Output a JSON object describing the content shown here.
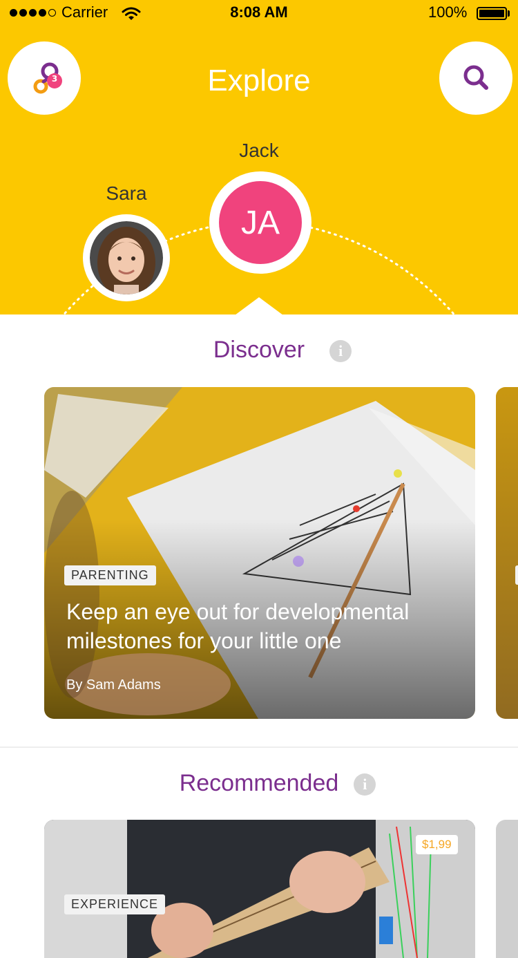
{
  "status_bar": {
    "carrier": "Carrier",
    "time": "8:08 AM",
    "battery": "100%"
  },
  "header": {
    "title": "Explore",
    "notification_count": "3",
    "background_color": "#FCC800",
    "accent_color": "#7B2E8E"
  },
  "profiles": {
    "secondary": {
      "name": "Sara"
    },
    "active": {
      "name": "Jack",
      "initials": "JA",
      "color": "#F0437D"
    }
  },
  "discover": {
    "title": "Discover",
    "info_icon": "i",
    "card": {
      "tag": "PARENTING",
      "title": "Keep an eye out for developmental milestones for your little one",
      "author": "By Sam Adams"
    }
  },
  "recommended": {
    "title": "Recommended",
    "info_icon": "i",
    "card": {
      "tag": "EXPERIENCE",
      "price": "$1,99"
    }
  }
}
